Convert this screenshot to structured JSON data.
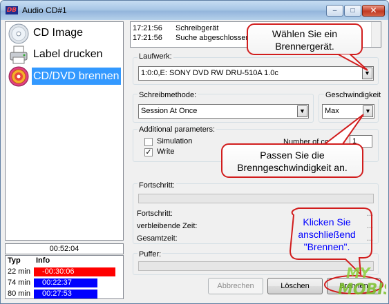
{
  "window": {
    "title": "Audio CD#1",
    "logo_text": "DB"
  },
  "nav": [
    {
      "label": "CD Image",
      "icon": "cd-icon"
    },
    {
      "label": "Label drucken",
      "icon": "printer-icon"
    },
    {
      "label": "CD/DVD brennen",
      "icon": "burn-cd-icon",
      "selected": true
    }
  ],
  "total_time": "00:52:04",
  "info_table": {
    "headers": [
      "Typ",
      "Info"
    ],
    "rows": [
      {
        "typ": "22 min",
        "info": "-00:30:06",
        "color": "#ff0000"
      },
      {
        "typ": "74 min",
        "info": "00:22:37",
        "color": "#0000ff"
      },
      {
        "typ": "80 min",
        "info": "00:27:53",
        "color": "#0000ff"
      }
    ]
  },
  "log": [
    {
      "time": "17:21:56",
      "message": "Schreibgerät"
    },
    {
      "time": "17:21:56",
      "message": "Suche abgeschlossen"
    }
  ],
  "laufwerk": {
    "label": "Laufwerk:",
    "value": "1:0:0,E: SONY     DVD RW DRU-510A 1.0c"
  },
  "schreibmethode": {
    "label": "Schreibmethode:",
    "value": "Session At Once"
  },
  "geschwindigkeit": {
    "label": "Geschwindigkeit",
    "value": "Max"
  },
  "additional": {
    "label": "Additional parameters:",
    "simulation_label": "Simulation",
    "simulation_checked": false,
    "write_label": "Write",
    "write_checked": true,
    "number_label": "Number of copies:",
    "number_value": "1"
  },
  "fortschritt_group": {
    "label": "Fortschritt:",
    "fields": [
      "Fortschritt:",
      "verbleibende Zeit:",
      "Gesamtzeit:"
    ]
  },
  "puffer": {
    "label": "Puffer:"
  },
  "buttons": {
    "abbrechen": "Abbrechen",
    "loeschen": "Löschen",
    "brennen": "Brennen"
  },
  "callouts": {
    "brenner": [
      "Wählen Sie ein",
      "Brennergerät."
    ],
    "speed": [
      "Passen Sie die",
      "Brenngeschwindigkeit an."
    ],
    "brennen": [
      "Klicken Sie",
      "anschließend",
      "\"Brennen\"."
    ]
  },
  "watermark": "MY MOBIS"
}
